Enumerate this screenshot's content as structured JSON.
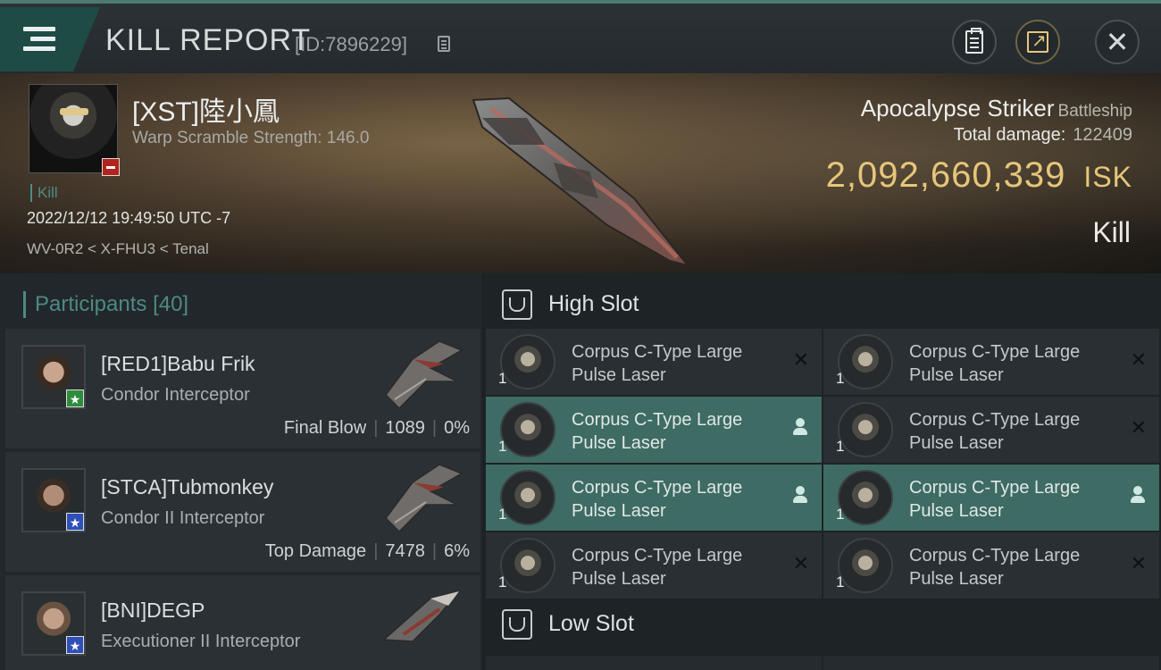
{
  "header": {
    "title": "KILL REPORT",
    "report_id": "[ID:7896229]"
  },
  "victim": {
    "name": "[XST]陸小鳳",
    "warp_scramble": "Warp Scramble Strength: 146.0",
    "tag": "Kill",
    "datetime": "2022/12/12 19:49:50 UTC -7",
    "location": "WV-0R2 < X-FHU3 < Tenal",
    "ship_name": "Apocalypse Striker",
    "ship_class": "Battleship",
    "total_damage_label": "Total damage:",
    "total_damage": "122409",
    "isk_value": "2,092,660,339",
    "isk_unit": "ISK",
    "result": "Kill"
  },
  "participants": {
    "label": "Participants",
    "count": "[40]",
    "items": [
      {
        "name": "[RED1]Babu Frik",
        "ship": "Condor Interceptor",
        "role": "Final Blow",
        "damage": "1089",
        "percent": "0%"
      },
      {
        "name": "[STCA]Tubmonkey",
        "ship": "Condor II Interceptor",
        "role": "Top Damage",
        "damage": "7478",
        "percent": "6%"
      },
      {
        "name": "[BNI]DEGP",
        "ship": "Executioner II Interceptor",
        "role": "",
        "damage": "",
        "percent": ""
      }
    ]
  },
  "fitting": {
    "high_slot_label": "High Slot",
    "low_slot_label": "Low Slot",
    "high_slots": [
      {
        "line1": "Corpus C-Type Large",
        "line2": "Pulse Laser",
        "qty": "1",
        "status": "destroyed"
      },
      {
        "line1": "Corpus C-Type Large",
        "line2": "Pulse Laser",
        "qty": "1",
        "status": "destroyed"
      },
      {
        "line1": "Corpus C-Type Large",
        "line2": "Pulse Laser",
        "qty": "1",
        "status": "dropped"
      },
      {
        "line1": "Corpus C-Type Large",
        "line2": "Pulse Laser",
        "qty": "1",
        "status": "destroyed"
      },
      {
        "line1": "Corpus C-Type Large",
        "line2": "Pulse Laser",
        "qty": "1",
        "status": "dropped"
      },
      {
        "line1": "Corpus C-Type Large",
        "line2": "Pulse Laser",
        "qty": "1",
        "status": "dropped"
      },
      {
        "line1": "Corpus C-Type Large",
        "line2": "Pulse Laser",
        "qty": "1",
        "status": "destroyed"
      },
      {
        "line1": "Corpus C-Type Large",
        "line2": "Pulse Laser",
        "qty": "1",
        "status": "destroyed"
      }
    ]
  },
  "icons": {
    "menu": "menu-icon",
    "copy": "copy-icon",
    "clipboard": "clipboard-icon",
    "share": "share-icon",
    "close": "close-icon",
    "destroyed": "x-icon",
    "dropped": "person-icon"
  },
  "colors": {
    "accent_teal": "#4d8a82",
    "isk_gold": "#e6c67a",
    "dropped_bg": "#3e6b63",
    "security_negative": "#b3231d"
  }
}
